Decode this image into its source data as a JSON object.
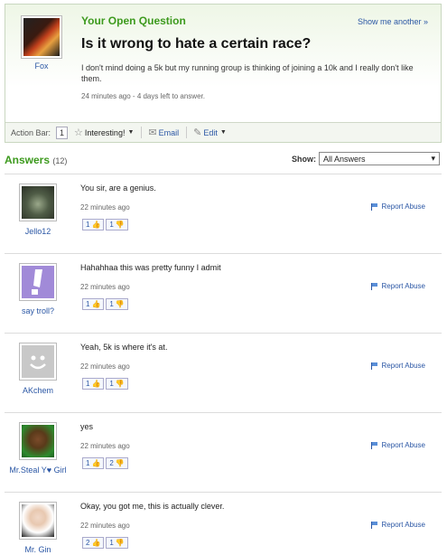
{
  "question": {
    "header": "Your Open Question",
    "show_another": "Show me another »",
    "title": "Is it wrong to hate a certain race?",
    "body": "I don't mind doing a 5k but my running group is thinking of joining a 10k and I really don't like them.",
    "meta": "24 minutes ago - 4 days left to answer.",
    "user": "Fox",
    "avatar_icon": "fox-avatar"
  },
  "action_bar": {
    "label": "Action Bar:",
    "interesting_count": "1",
    "interesting": "Interesting!",
    "email": "Email",
    "edit": "Edit"
  },
  "answers_section": {
    "title": "Answers",
    "count": "(12)",
    "show_label": "Show:",
    "show_value": "All Answers"
  },
  "answers": [
    {
      "text": "You sir, are a genius.",
      "time": "22 minutes ago",
      "user": "Jello12",
      "up": "1",
      "down": "1",
      "report": "Report Abuse"
    },
    {
      "text": "Hahahhaa this was pretty funny I admit",
      "time": "22 minutes ago",
      "user": "say troll?",
      "up": "1",
      "down": "1",
      "report": "Report Abuse"
    },
    {
      "text": "Yeah, 5k is where it's at.",
      "time": "22 minutes ago",
      "user": "AKchem",
      "up": "1",
      "down": "1",
      "report": "Report Abuse"
    },
    {
      "text": "yes",
      "time": "22 minutes ago",
      "user": "Mr.Steal Y♥ Girl",
      "up": "1",
      "down": "2",
      "report": "Report Abuse"
    },
    {
      "text": "Okay, you got me, this is actually clever.",
      "time": "22 minutes ago",
      "user": "Mr. Gin",
      "up": "2",
      "down": "1",
      "report": "Report Abuse"
    }
  ]
}
